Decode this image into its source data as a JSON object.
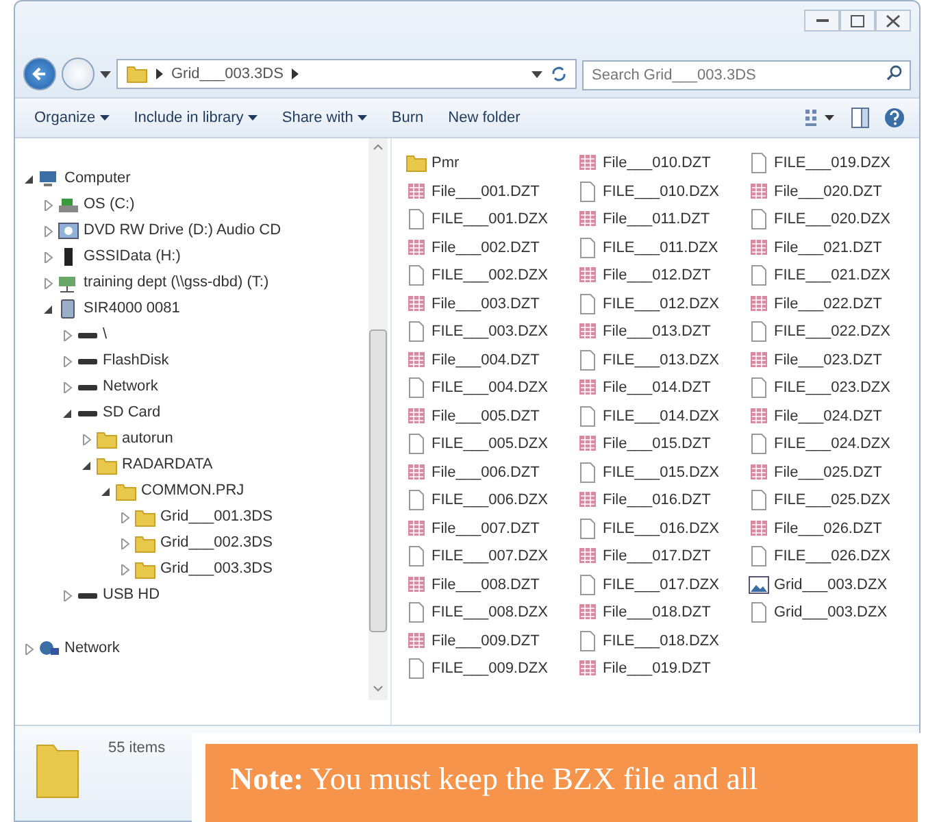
{
  "address_bar": {
    "path": "Grid___003.3DS",
    "search_placeholder": "Search Grid___003.3DS"
  },
  "toolbar": {
    "items": [
      {
        "label": "Organize",
        "dropdown": true
      },
      {
        "label": "Include in library",
        "dropdown": true
      },
      {
        "label": "Share with",
        "dropdown": true
      },
      {
        "label": "Burn",
        "dropdown": false
      },
      {
        "label": "New folder",
        "dropdown": false
      }
    ]
  },
  "nav_tree": [
    {
      "label": "Computer",
      "kind": "computer",
      "expanded": true,
      "children": [
        {
          "label": "OS (C:)",
          "kind": "drive",
          "expanded": false
        },
        {
          "label": "DVD RW Drive (D:) Audio CD",
          "kind": "dvd",
          "expanded": false
        },
        {
          "label": "GSSIData (H:)",
          "kind": "usb",
          "expanded": false
        },
        {
          "label": "training dept (\\\\gss-dbd) (T:)",
          "kind": "netdrive",
          "expanded": false
        },
        {
          "label": "SIR4000 0081",
          "kind": "device",
          "expanded": true,
          "children": [
            {
              "label": "\\",
              "kind": "disk",
              "expanded": false
            },
            {
              "label": "FlashDisk",
              "kind": "disk",
              "expanded": false
            },
            {
              "label": "Network",
              "kind": "disk",
              "expanded": false
            },
            {
              "label": "SD Card",
              "kind": "disk",
              "expanded": true,
              "children": [
                {
                  "label": "autorun",
                  "kind": "folder",
                  "expanded": false
                },
                {
                  "label": "RADARDATA",
                  "kind": "folder",
                  "expanded": true,
                  "children": [
                    {
                      "label": "COMMON.PRJ",
                      "kind": "folder",
                      "expanded": true,
                      "children": [
                        {
                          "label": "Grid___001.3DS",
                          "kind": "folder",
                          "expanded": false
                        },
                        {
                          "label": "Grid___002.3DS",
                          "kind": "folder",
                          "expanded": false
                        },
                        {
                          "label": "Grid___003.3DS",
                          "kind": "folder",
                          "expanded": false
                        }
                      ]
                    }
                  ]
                }
              ]
            },
            {
              "label": "USB HD",
              "kind": "disk",
              "expanded": false
            }
          ]
        }
      ]
    },
    {
      "label": "Network",
      "kind": "network",
      "expanded": false
    }
  ],
  "files": [
    {
      "name": "Pmr",
      "kind": "folder"
    },
    {
      "name": "File___001.DZT",
      "kind": "dzt"
    },
    {
      "name": "FILE___001.DZX",
      "kind": "dzx"
    },
    {
      "name": "File___002.DZT",
      "kind": "dzt"
    },
    {
      "name": "FILE___002.DZX",
      "kind": "dzx"
    },
    {
      "name": "File___003.DZT",
      "kind": "dzt"
    },
    {
      "name": "FILE___003.DZX",
      "kind": "dzx"
    },
    {
      "name": "File___004.DZT",
      "kind": "dzt"
    },
    {
      "name": "FILE___004.DZX",
      "kind": "dzx"
    },
    {
      "name": "File___005.DZT",
      "kind": "dzt"
    },
    {
      "name": "FILE___005.DZX",
      "kind": "dzx"
    },
    {
      "name": "File___006.DZT",
      "kind": "dzt"
    },
    {
      "name": "FILE___006.DZX",
      "kind": "dzx"
    },
    {
      "name": "File___007.DZT",
      "kind": "dzt"
    },
    {
      "name": "FILE___007.DZX",
      "kind": "dzx"
    },
    {
      "name": "File___008.DZT",
      "kind": "dzt"
    },
    {
      "name": "FILE___008.DZX",
      "kind": "dzx"
    },
    {
      "name": "File___009.DZT",
      "kind": "dzt"
    },
    {
      "name": "FILE___009.DZX",
      "kind": "dzx"
    },
    {
      "name": "File___010.DZT",
      "kind": "dzt"
    },
    {
      "name": "FILE___010.DZX",
      "kind": "dzx"
    },
    {
      "name": "File___011.DZT",
      "kind": "dzt"
    },
    {
      "name": "FILE___011.DZX",
      "kind": "dzx"
    },
    {
      "name": "File___012.DZT",
      "kind": "dzt"
    },
    {
      "name": "FILE___012.DZX",
      "kind": "dzx"
    },
    {
      "name": "File___013.DZT",
      "kind": "dzt"
    },
    {
      "name": "FILE___013.DZX",
      "kind": "dzx"
    },
    {
      "name": "File___014.DZT",
      "kind": "dzt"
    },
    {
      "name": "FILE___014.DZX",
      "kind": "dzx"
    },
    {
      "name": "File___015.DZT",
      "kind": "dzt"
    },
    {
      "name": "FILE___015.DZX",
      "kind": "dzx"
    },
    {
      "name": "File___016.DZT",
      "kind": "dzt"
    },
    {
      "name": "FILE___016.DZX",
      "kind": "dzx"
    },
    {
      "name": "File___017.DZT",
      "kind": "dzt"
    },
    {
      "name": "FILE___017.DZX",
      "kind": "dzx"
    },
    {
      "name": "File___018.DZT",
      "kind": "dzt"
    },
    {
      "name": "FILE___018.DZX",
      "kind": "dzx"
    },
    {
      "name": "File___019.DZT",
      "kind": "dzt"
    },
    {
      "name": "FILE___019.DZX",
      "kind": "dzx"
    },
    {
      "name": "File___020.DZT",
      "kind": "dzt"
    },
    {
      "name": "FILE___020.DZX",
      "kind": "dzx"
    },
    {
      "name": "File___021.DZT",
      "kind": "dzt"
    },
    {
      "name": "FILE___021.DZX",
      "kind": "dzx"
    },
    {
      "name": "File___022.DZT",
      "kind": "dzt"
    },
    {
      "name": "FILE___022.DZX",
      "kind": "dzx"
    },
    {
      "name": "File___023.DZT",
      "kind": "dzt"
    },
    {
      "name": "FILE___023.DZX",
      "kind": "dzx"
    },
    {
      "name": "File___024.DZT",
      "kind": "dzt"
    },
    {
      "name": "FILE___024.DZX",
      "kind": "dzx"
    },
    {
      "name": "File___025.DZT",
      "kind": "dzt"
    },
    {
      "name": "FILE___025.DZX",
      "kind": "dzx"
    },
    {
      "name": "File___026.DZT",
      "kind": "dzt"
    },
    {
      "name": "FILE___026.DZX",
      "kind": "dzx"
    },
    {
      "name": "Grid___003.DZX",
      "kind": "image"
    },
    {
      "name": "Grid___003.DZX",
      "kind": "dzx"
    }
  ],
  "details_pane": {
    "count": "55 items"
  },
  "note": {
    "text": "**Note:** You must keep the BZX file and all"
  }
}
